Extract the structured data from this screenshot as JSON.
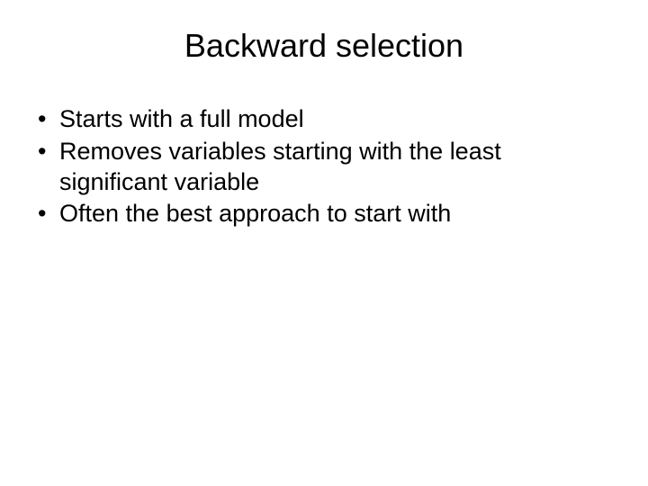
{
  "slide": {
    "title": "Backward selection",
    "bullets": [
      "Starts with a full model",
      "Removes variables starting with the least significant variable",
      "Often the best approach to start with"
    ]
  }
}
